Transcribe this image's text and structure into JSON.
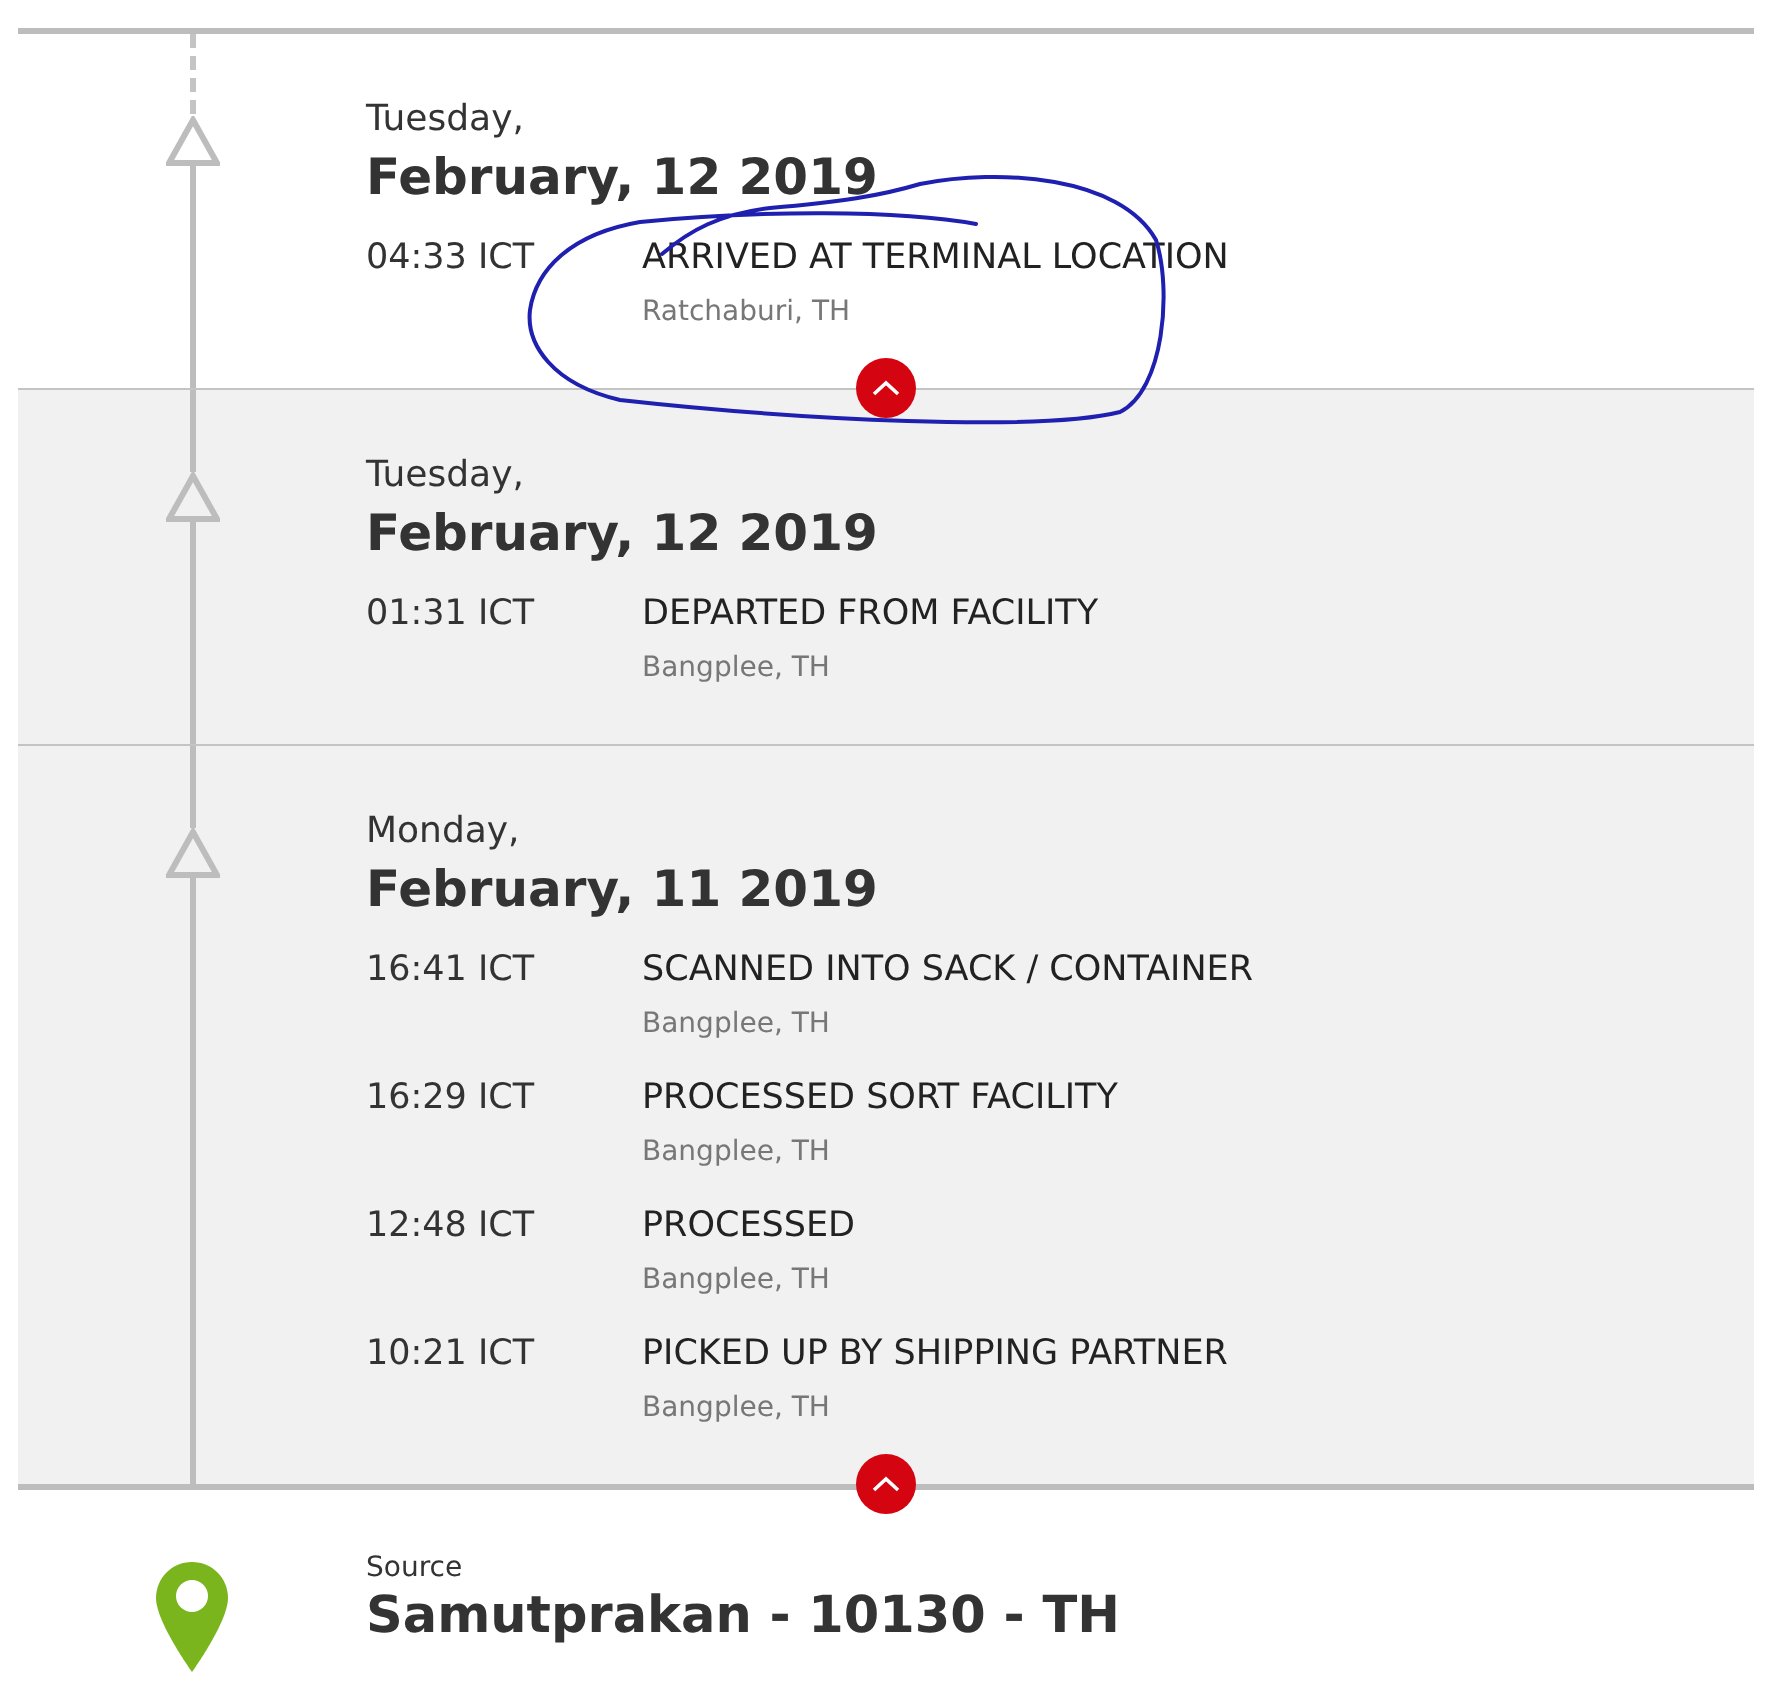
{
  "timeline": {
    "continues_above": true
  },
  "groups": [
    {
      "day": "Tuesday,",
      "date": "February, 12 2019",
      "shaded": false,
      "toggle": {
        "expanded": true
      },
      "events": [
        {
          "time": "04:33 ICT",
          "status": "ARRIVED AT TERMINAL LOCATION",
          "location": "Ratchaburi, TH"
        }
      ]
    },
    {
      "day": "Tuesday,",
      "date": "February, 12 2019",
      "shaded": true,
      "events": [
        {
          "time": "01:31 ICT",
          "status": "DEPARTED FROM FACILITY",
          "location": "Bangplee, TH"
        }
      ]
    },
    {
      "day": "Monday,",
      "date": "February, 11 2019",
      "shaded": true,
      "toggle": {
        "expanded": true
      },
      "events": [
        {
          "time": "16:41 ICT",
          "status": "SCANNED INTO SACK / CONTAINER",
          "location": "Bangplee, TH"
        },
        {
          "time": "16:29 ICT",
          "status": "PROCESSED SORT FACILITY",
          "location": "Bangplee, TH"
        },
        {
          "time": "12:48 ICT",
          "status": "PROCESSED",
          "location": "Bangplee, TH"
        },
        {
          "time": "10:21 ICT",
          "status": "PICKED UP BY SHIPPING PARTNER",
          "location": "Bangplee, TH"
        }
      ]
    }
  ],
  "source": {
    "label": "Source",
    "location": "Samutprakan - 10130 - TH"
  }
}
